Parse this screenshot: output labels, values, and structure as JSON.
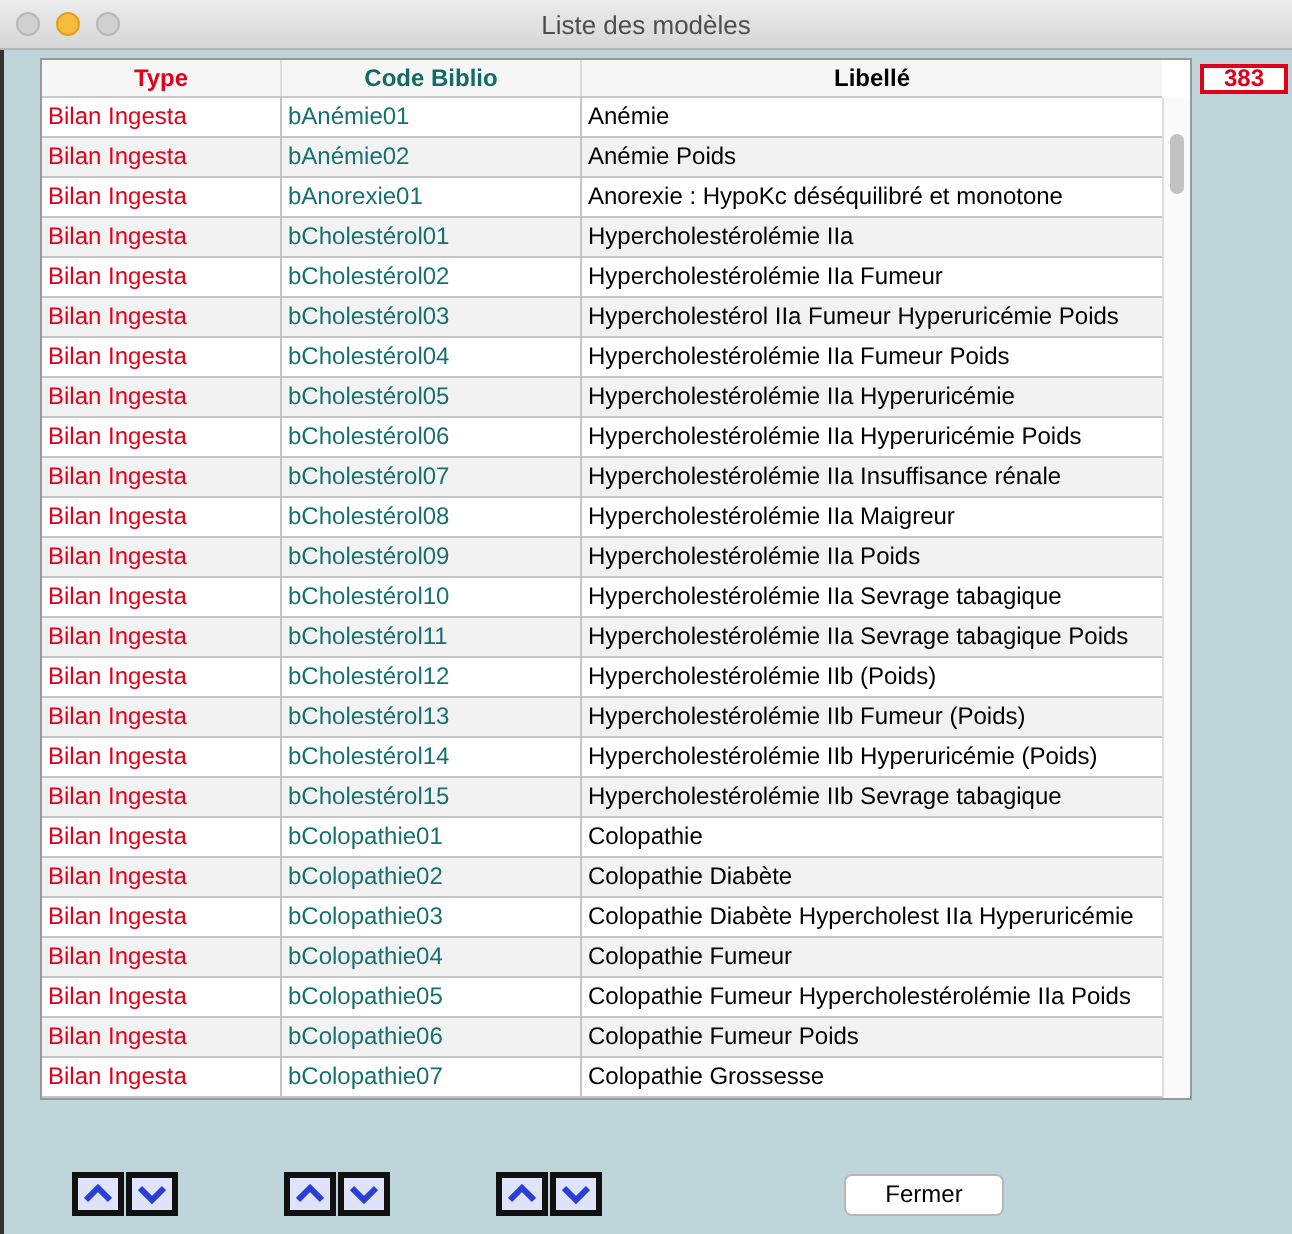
{
  "window": {
    "title": "Liste des modèles"
  },
  "count": "383",
  "table": {
    "columns": [
      "Type",
      "Code Biblio",
      "Libellé"
    ],
    "rows": [
      [
        "Bilan Ingesta",
        "bAnémie01",
        "Anémie"
      ],
      [
        "Bilan Ingesta",
        "bAnémie02",
        "Anémie Poids"
      ],
      [
        "Bilan Ingesta",
        "bAnorexie01",
        "Anorexie : HypoKc déséquilibré et monotone"
      ],
      [
        "Bilan Ingesta",
        "bCholestérol01",
        "Hypercholestérolémie IIa"
      ],
      [
        "Bilan Ingesta",
        "bCholestérol02",
        "Hypercholestérolémie IIa Fumeur"
      ],
      [
        "Bilan Ingesta",
        "bCholestérol03",
        "Hypercholestérol IIa Fumeur Hyperuricémie Poids"
      ],
      [
        "Bilan Ingesta",
        "bCholestérol04",
        "Hypercholestérolémie IIa Fumeur Poids"
      ],
      [
        "Bilan Ingesta",
        "bCholestérol05",
        "Hypercholestérolémie IIa Hyperuricémie"
      ],
      [
        "Bilan Ingesta",
        "bCholestérol06",
        "Hypercholestérolémie IIa Hyperuricémie Poids"
      ],
      [
        "Bilan Ingesta",
        "bCholestérol07",
        "Hypercholestérolémie IIa Insuffisance rénale"
      ],
      [
        "Bilan Ingesta",
        "bCholestérol08",
        "Hypercholestérolémie IIa Maigreur"
      ],
      [
        "Bilan Ingesta",
        "bCholestérol09",
        "Hypercholestérolémie IIa Poids"
      ],
      [
        "Bilan Ingesta",
        "bCholestérol10",
        "Hypercholestérolémie IIa Sevrage tabagique"
      ],
      [
        "Bilan Ingesta",
        "bCholestérol11",
        "Hypercholestérolémie IIa Sevrage tabagique Poids"
      ],
      [
        "Bilan Ingesta",
        "bCholestérol12",
        "Hypercholestérolémie IIb (Poids)"
      ],
      [
        "Bilan Ingesta",
        "bCholestérol13",
        "Hypercholestérolémie IIb Fumeur (Poids)"
      ],
      [
        "Bilan Ingesta",
        "bCholestérol14",
        "Hypercholestérolémie IIb Hyperuricémie (Poids)"
      ],
      [
        "Bilan Ingesta",
        "bCholestérol15",
        "Hypercholestérolémie IIb Sevrage tabagique"
      ],
      [
        "Bilan Ingesta",
        "bColopathie01",
        "Colopathie"
      ],
      [
        "Bilan Ingesta",
        "bColopathie02",
        "Colopathie Diabète"
      ],
      [
        "Bilan Ingesta",
        "bColopathie03",
        "Colopathie Diabète Hypercholest IIa Hyperuricémie"
      ],
      [
        "Bilan Ingesta",
        "bColopathie04",
        "Colopathie Fumeur"
      ],
      [
        "Bilan Ingesta",
        "bColopathie05",
        "Colopathie Fumeur Hypercholestérolémie IIa Poids"
      ],
      [
        "Bilan Ingesta",
        "bColopathie06",
        "Colopathie Fumeur Poids"
      ],
      [
        "Bilan Ingesta",
        "bColopathie07",
        "Colopathie Grossesse"
      ]
    ]
  },
  "buttons": [
    {
      "label": "Fermer"
    }
  ]
}
